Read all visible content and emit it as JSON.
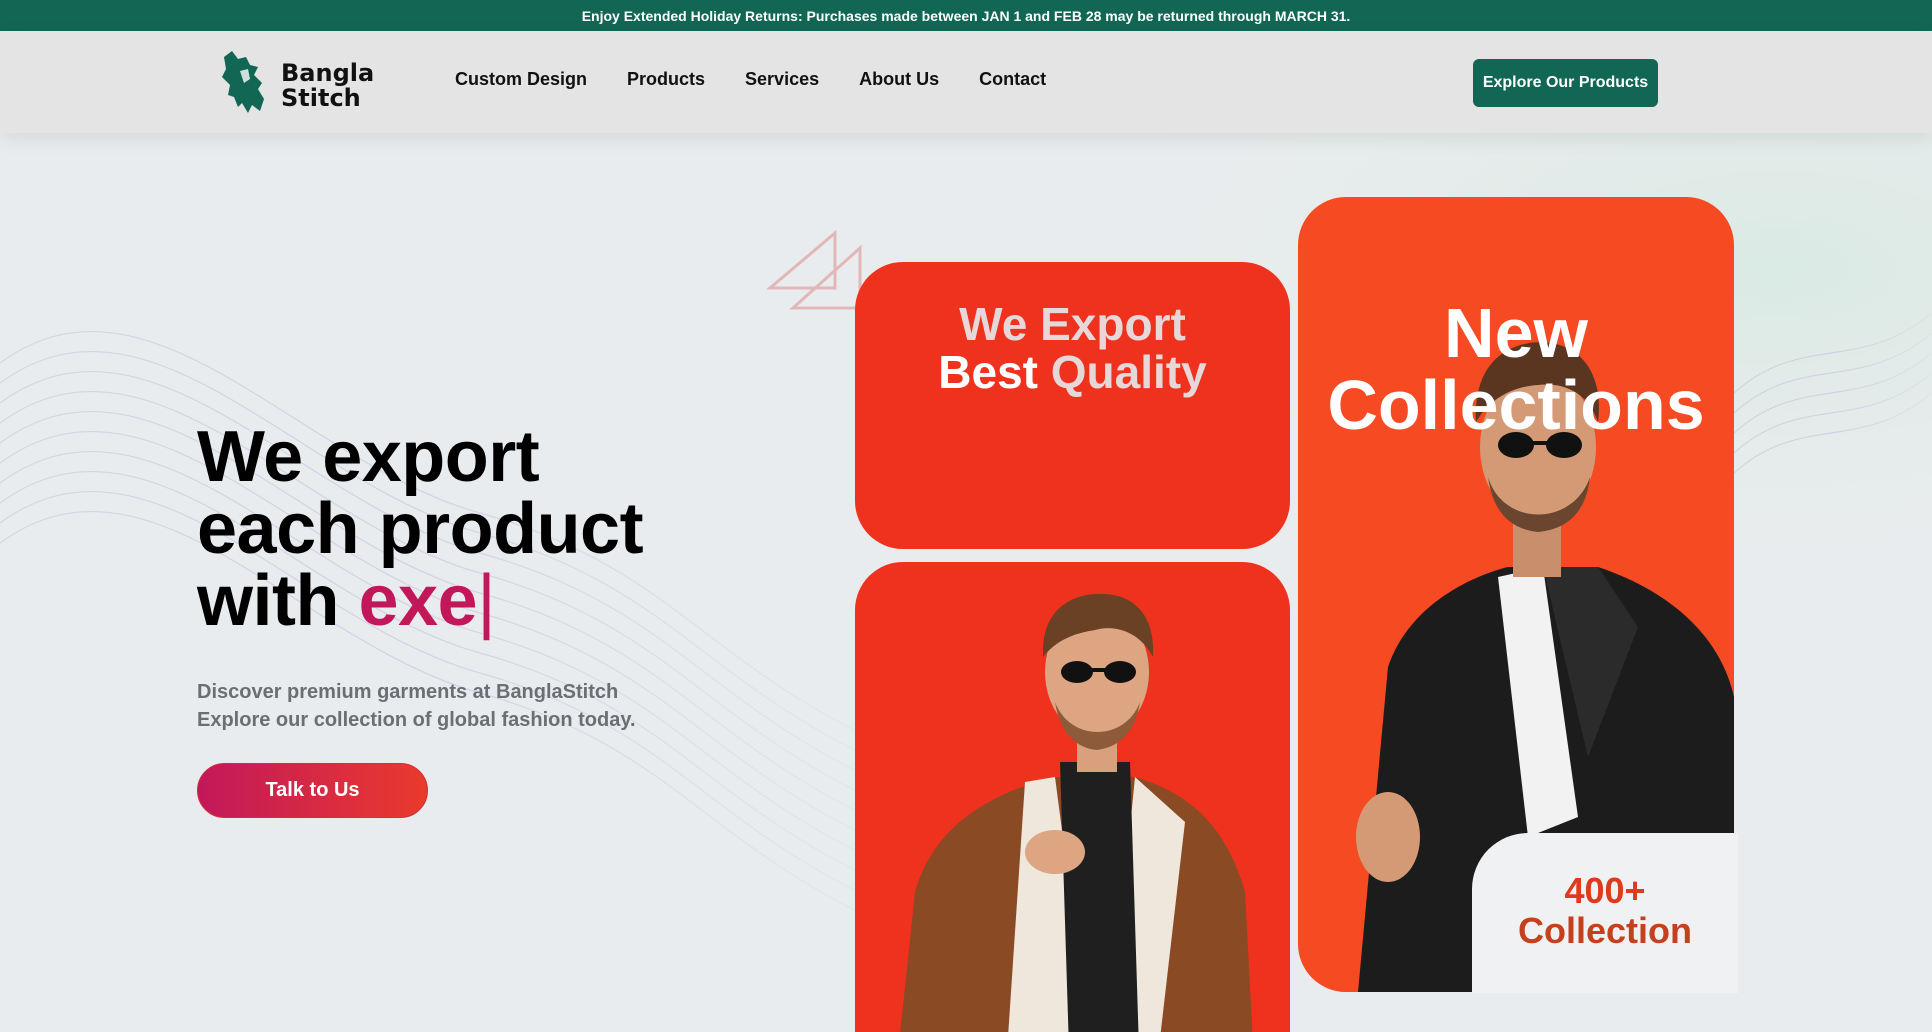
{
  "announcement": "Enjoy Extended Holiday Returns: Purchases made between JAN 1 and FEB 28 may be returned through MARCH 31.",
  "brand": {
    "line1": "Bangla",
    "line2": "Stitch",
    "color": "#116753"
  },
  "nav": {
    "items": [
      "Custom Design",
      "Products",
      "Services",
      "About Us",
      "Contact"
    ]
  },
  "header_cta": "Explore Our Products",
  "hero": {
    "headline_line1": "We export",
    "headline_line2": "each product",
    "headline_line3_prefix": "with ",
    "headline_typed": "exe",
    "caret": "|",
    "description_line1": "Discover premium garments at BanglaStitch",
    "description_line2": "Explore our collection of global fashion today.",
    "button": "Talk to Us"
  },
  "cards": {
    "export_line1": "We Export",
    "export_best": "Best",
    "export_quality": "Quality",
    "new_line1": "New",
    "new_line2": "Collections"
  },
  "badge": {
    "count": "400+",
    "label": "Collection"
  },
  "colors": {
    "brand_green": "#116753",
    "accent_pink": "#c2185b",
    "card_red": "#ee321d",
    "card_orange": "#f54a22"
  }
}
